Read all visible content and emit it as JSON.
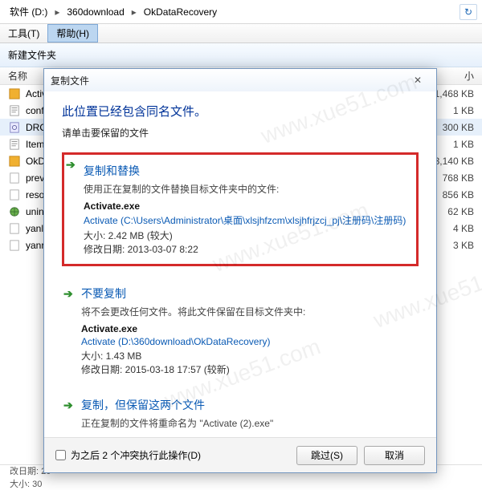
{
  "addr": {
    "seg1": "软件 (D:)",
    "seg2": "360download",
    "seg3": "OkDataRecovery"
  },
  "menu": {
    "tools": "工具(T)",
    "help": "帮助(H)"
  },
  "toolbar": {
    "newfolder": "新建文件夹"
  },
  "columns": {
    "name": "名称",
    "size": "小"
  },
  "files": [
    {
      "n": "Activ",
      "s": "1,468 KB"
    },
    {
      "n": "conf",
      "s": "1 KB"
    },
    {
      "n": "DRO",
      "s": "300 KB"
    },
    {
      "n": "Item",
      "s": "1 KB"
    },
    {
      "n": "OkD",
      "s": "3,140 KB"
    },
    {
      "n": "prev",
      "s": "768 KB"
    },
    {
      "n": "reso",
      "s": "856 KB"
    },
    {
      "n": "unin",
      "s": "62 KB"
    },
    {
      "n": "yanl",
      "s": "4 KB"
    },
    {
      "n": "yanr",
      "s": "3 KB"
    }
  ],
  "status": {
    "l1": "改日期: 20",
    "l2": "大小: 30"
  },
  "dialog": {
    "title": "复制文件",
    "heading": "此位置已经包含同名文件。",
    "sub": "请单击要保留的文件",
    "opt1": {
      "title": "复制和替换",
      "desc": "使用正在复制的文件替换目标文件夹中的文件:",
      "fname": "Activate.exe",
      "path": "Activate (C:\\Users\\Administrator\\桌面\\xlsjhfzcm\\xlsjhfrjzcj_pj\\注册码\\注册码)",
      "size": "大小: 2.42 MB (较大)",
      "date": "修改日期: 2013-03-07 8:22"
    },
    "opt2": {
      "title": "不要复制",
      "desc": "将不会更改任何文件。将此文件保留在目标文件夹中:",
      "fname": "Activate.exe",
      "path": "Activate (D:\\360download\\OkDataRecovery)",
      "size": "大小: 1.43 MB",
      "date": "修改日期: 2015-03-18 17:57 (较新)"
    },
    "opt3": {
      "title": "复制，但保留这两个文件",
      "desc": "正在复制的文件将重命名为 \"Activate (2).exe\""
    },
    "checkbox": "为之后 2 个冲突执行此操作(D)",
    "skip": "跳过(S)",
    "cancel": "取消"
  },
  "wm": "www.xue51.com"
}
